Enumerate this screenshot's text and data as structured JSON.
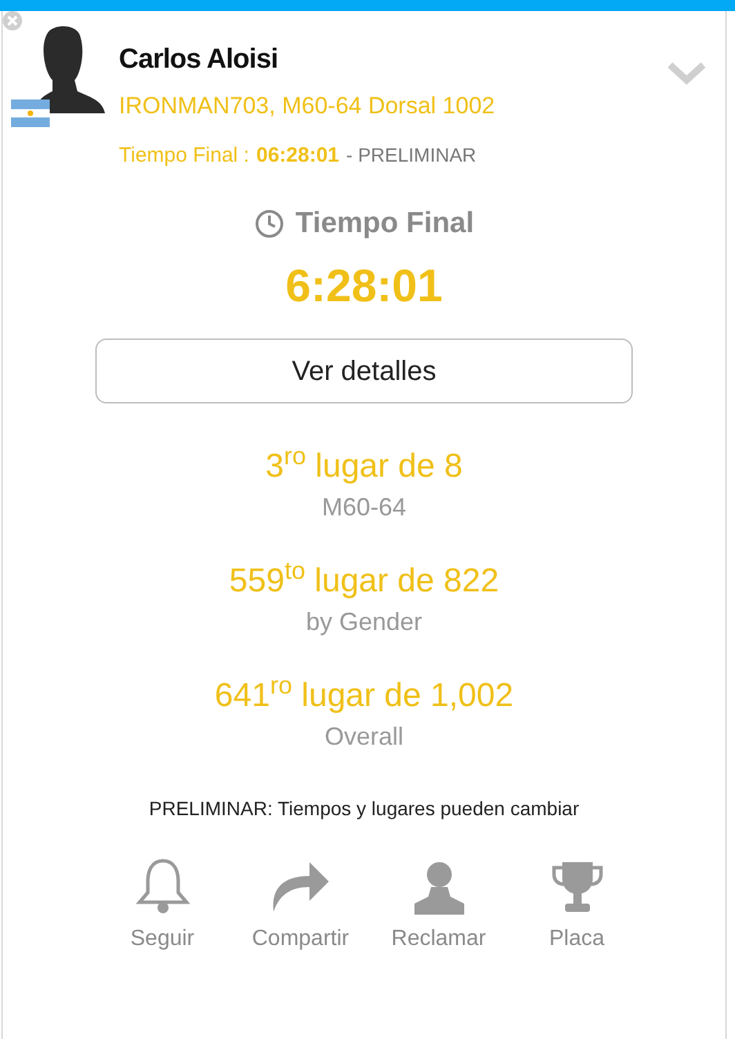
{
  "athlete": {
    "name": "Carlos Aloisi",
    "race_line": "IRONMAN703, M60-64 Dorsal 1002",
    "final_label": "Tiempo Final :",
    "final_time": "06:28:01",
    "status": "- PRELIMINAR",
    "expanded": false
  },
  "result": {
    "title": "Tiempo Final",
    "time": "6:28:01",
    "details_button": "Ver detalles"
  },
  "ranks": [
    {
      "place": "3$^{ro}$ lugar de 8",
      "group": "M60-64"
    },
    {
      "place": "559$^{to}$ lugar de 822",
      "group": "by Gender"
    },
    {
      "place": "641$^{ro}$ lugar de 1,002",
      "group": "Overall"
    }
  ],
  "notice": "PRELIMINAR: Tiempos y lugares pueden cambiar",
  "actions": [
    {
      "kind": "follow",
      "label": "Seguir"
    },
    {
      "kind": "share",
      "label": "Compartir"
    },
    {
      "kind": "claim",
      "label": "Reclamar"
    },
    {
      "kind": "award",
      "label": "Placa"
    }
  ]
}
